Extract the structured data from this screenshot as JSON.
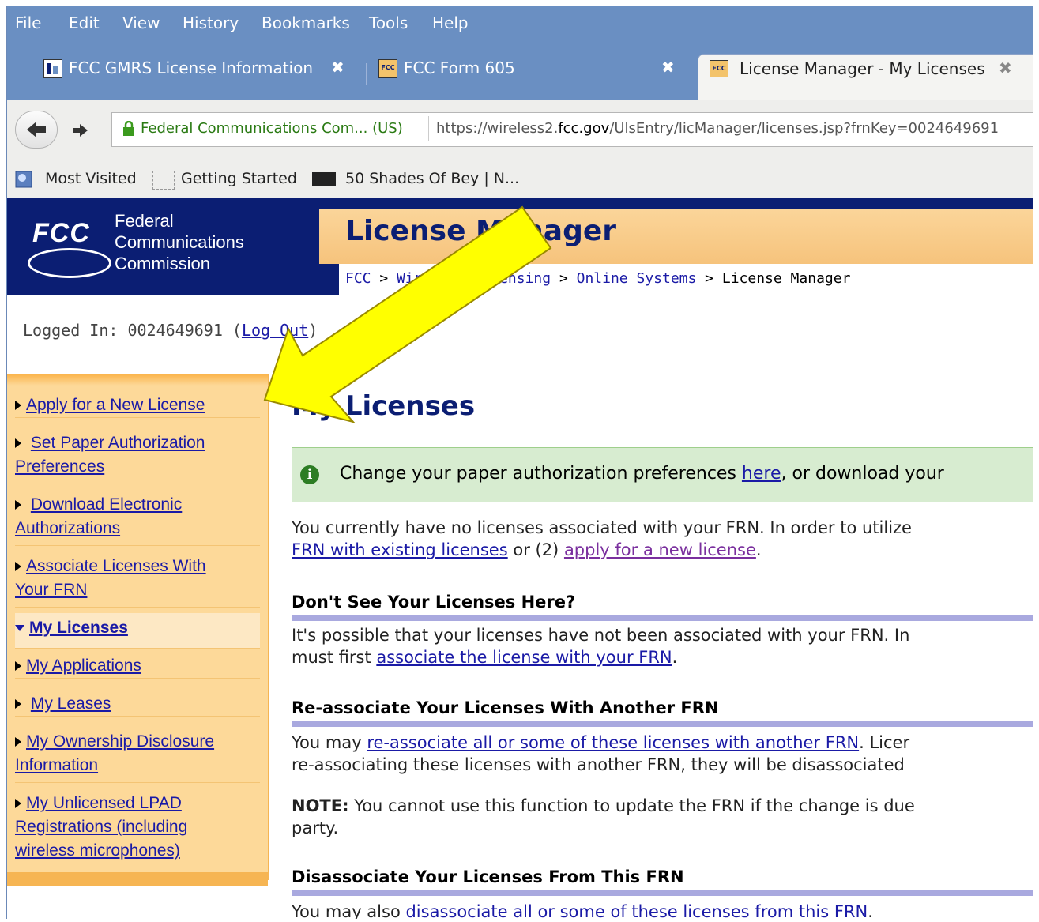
{
  "menu": [
    "File",
    "Edit",
    "View",
    "History",
    "Bookmarks",
    "Tools",
    "Help"
  ],
  "tabs": [
    {
      "label": "FCC GMRS License Information"
    },
    {
      "label": "FCC Form 605"
    },
    {
      "label": "License Manager - My Licenses"
    }
  ],
  "urlbar": {
    "site": "Federal Communications Com... (US)",
    "url_prefix": "https://wireless2.",
    "url_host": "fcc.gov",
    "url_rest": "/UlsEntry/licManager/licenses.jsp?frnKey=0024649691"
  },
  "bookmarks": [
    "Most Visited",
    "Getting Started",
    "50 Shades Of Bey | N..."
  ],
  "banner": {
    "fcc": "FCC",
    "name_line1": "Federal",
    "name_line2": "Communications",
    "name_line3": "Commission",
    "title": "License Manager"
  },
  "breadcrumb": {
    "c1": "FCC",
    "c2": "Wireless Licensing",
    "c3": "Online Systems",
    "current": "License Manager"
  },
  "logged": {
    "prefix": "Logged In: 0024649691 (",
    "link": "Log Out",
    "suffix": ")"
  },
  "sidebar": {
    "items": [
      {
        "label": "Apply for a New License"
      },
      {
        "label_l1": "Set Paper Authorization",
        "label_l2": "Preferences"
      },
      {
        "label_l1": "Download Electronic",
        "label_l2": "Authorizations"
      },
      {
        "label_l1": "Associate Licenses With",
        "label_l2": "Your FRN"
      },
      {
        "label": "My Licenses"
      },
      {
        "label": "My Applications"
      },
      {
        "label": "My Leases"
      },
      {
        "label_l1": "My Ownership Disclosure",
        "label_l2": "Information"
      },
      {
        "label_l1": "My Unlicensed LPAD",
        "label_l2": "Registrations (including",
        "label_l3": "wireless microphones)"
      }
    ]
  },
  "main": {
    "title": "My Licenses",
    "notice": {
      "pre": "Change your paper authorization preferences ",
      "link": "here",
      "post": ", or download your"
    },
    "p1": {
      "l1": "You currently have no licenses associated with your FRN. In order to utilize",
      "l2_link1": "FRN with existing licenses",
      "l2_mid": " or (2) ",
      "l2_link2": "apply for a new license",
      "l2_end": "."
    },
    "s1": "Don't See Your Licenses Here?",
    "p2": {
      "l1": "It's possible that your licenses have not been associated with your FRN. In",
      "l2_pre": "must first ",
      "l2_link": "associate the license with your FRN",
      "l2_end": "."
    },
    "s2": "Re-associate Your Licenses With Another FRN",
    "p3": {
      "l1_pre": "You may ",
      "l1_link": "re-associate all or some of these licenses with another FRN",
      "l1_end": ". Licer",
      "l2": "re-associating these licenses with another FRN, they will be disassociated"
    },
    "p4": {
      "bold": "NOTE:",
      "l1": " You cannot use this function to update the FRN if the change is due",
      "l2": "party."
    },
    "s3": "Disassociate Your Licenses From This FRN",
    "p5": {
      "pre": "You may also ",
      "link": "disassociate all or some of these licenses from this FRN",
      "end": "."
    }
  },
  "colors": {
    "chrome": "#6a8fc2",
    "fcc_blue": "#0b1e73",
    "sidebar": "#fdd999",
    "arrow": "#ffff00"
  }
}
